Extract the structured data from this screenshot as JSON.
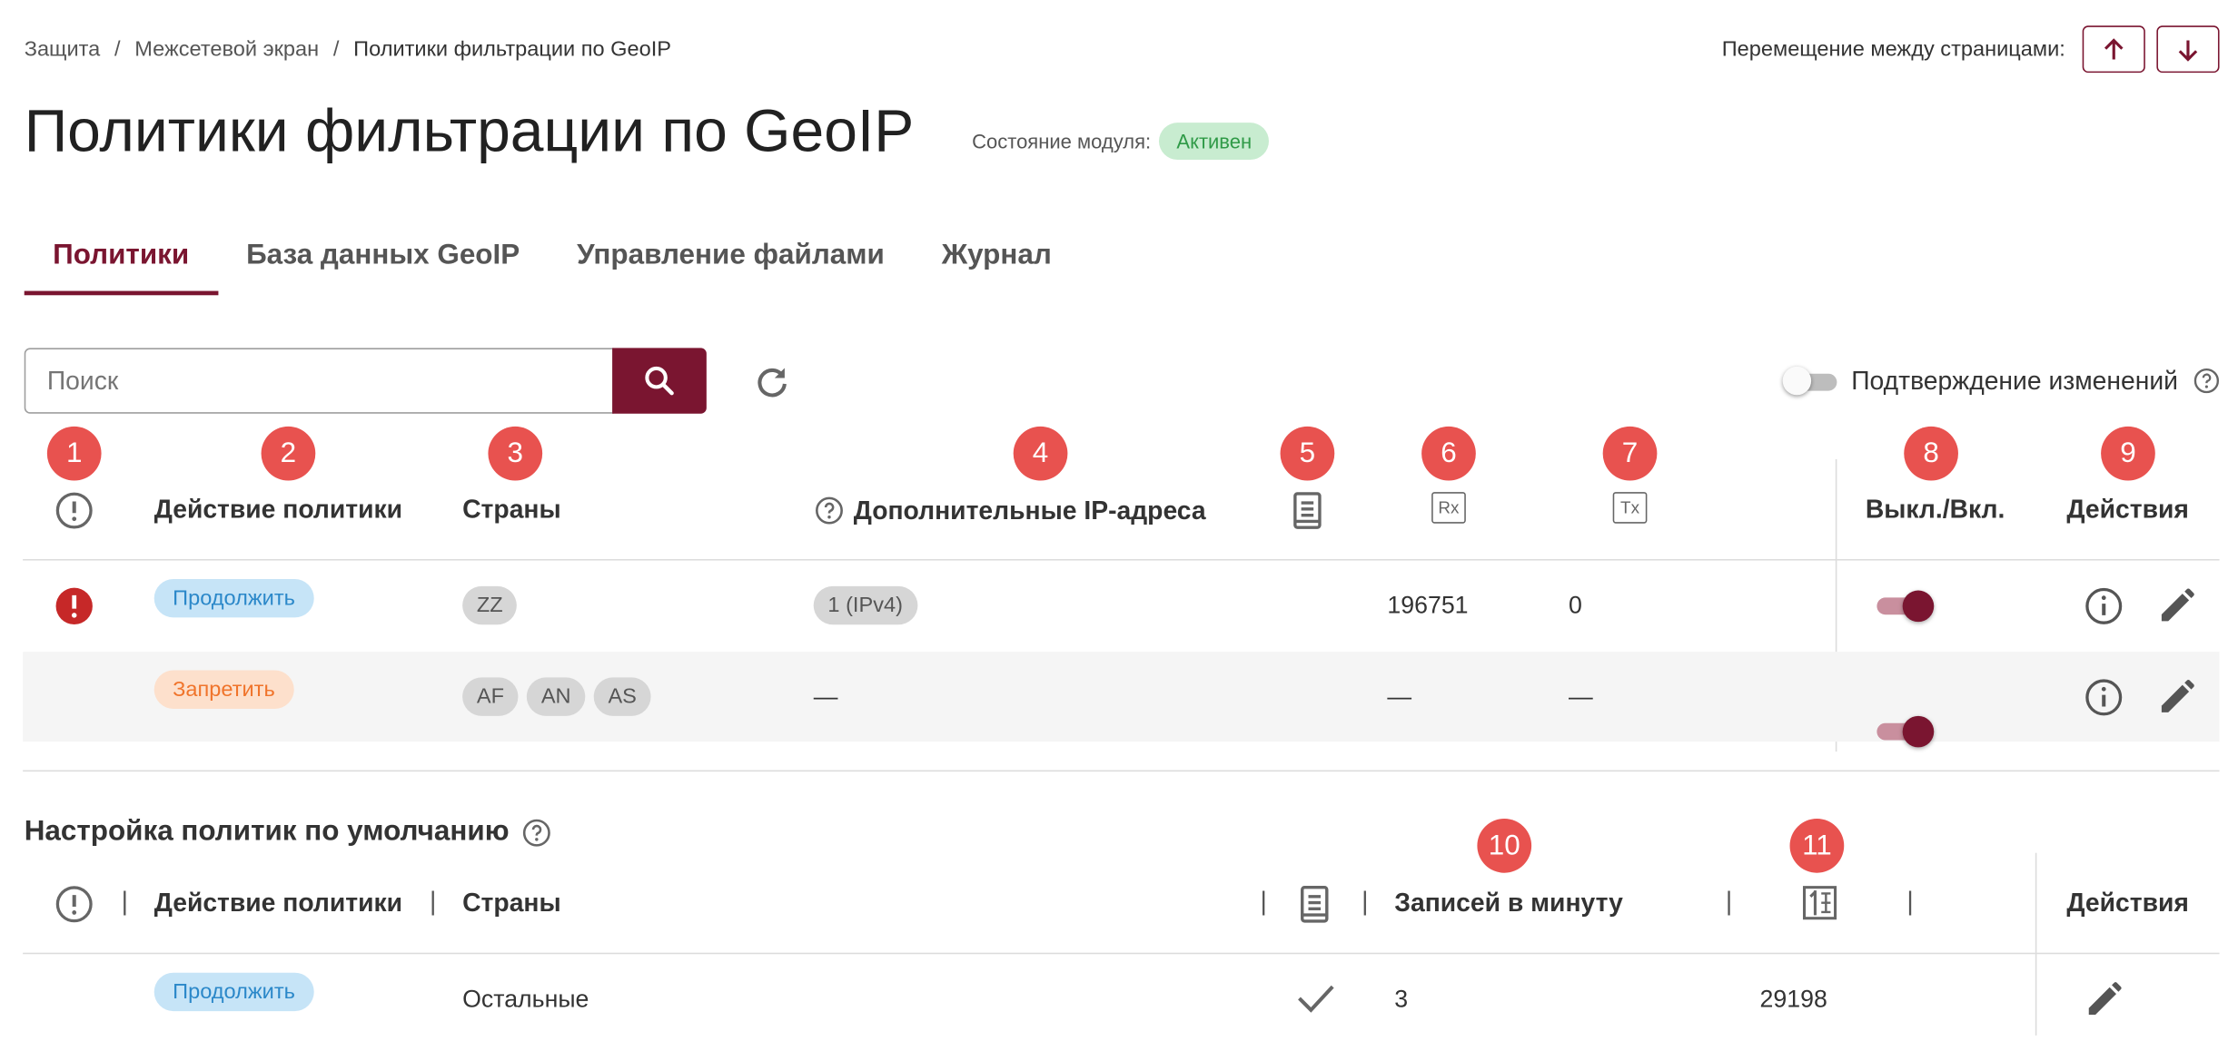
{
  "breadcrumb": [
    "Защита",
    "Межсетевой экран",
    "Политики фильтрации по GeoIP"
  ],
  "page_nav": {
    "label": "Перемещение между страницами:",
    "up_icon": "arrow-up-icon",
    "down_icon": "arrow-down-icon"
  },
  "title": "Политики фильтрации по GeoIP",
  "module_state": {
    "label": "Состояние модуля:",
    "value": "Активен",
    "color": "#2f9a47"
  },
  "tabs": [
    {
      "label": "Политики",
      "active": true
    },
    {
      "label": "База данных GeoIP",
      "active": false
    },
    {
      "label": "Управление файлами",
      "active": false
    },
    {
      "label": "Журнал",
      "active": false
    }
  ],
  "search": {
    "placeholder": "Поиск"
  },
  "confirm_changes": {
    "label": "Подтверждение изменений",
    "enabled": false
  },
  "markers": [
    "1",
    "2",
    "3",
    "4",
    "5",
    "6",
    "7",
    "8",
    "9",
    "10",
    "11"
  ],
  "table": {
    "headers": {
      "priority_icon": "exclamation-circle-icon",
      "action": "Действие политики",
      "countries": "Страны",
      "extra_ips": "Дополнительные IP-адреса",
      "log_icon": "document-icon",
      "rx": "Rx",
      "tx": "Tx",
      "toggle": "Выкл./Вкл.",
      "actions": "Действия"
    },
    "rows": [
      {
        "warning": true,
        "action": "Продолжить",
        "action_color": "#2b88c9",
        "countries": [
          "ZZ"
        ],
        "extra_ips": "1 (IPv4)",
        "rx": "196751",
        "tx": "0",
        "enabled": true
      },
      {
        "warning": false,
        "action": "Запретить",
        "action_color": "#f0742b",
        "countries": [
          "AF",
          "AN",
          "AS"
        ],
        "extra_ips": "—",
        "rx": "—",
        "tx": "—",
        "enabled": true
      }
    ]
  },
  "defaults": {
    "title": "Настройка политик по умолчанию",
    "headers": {
      "action": "Действие политики",
      "countries": "Страны",
      "records_per_minute": "Записей в минуту",
      "counter_icon": "counter-icon",
      "actions": "Действия"
    },
    "row": {
      "action": "Продолжить",
      "countries": "Остальные",
      "log": true,
      "records_per_minute": "3",
      "counter": "29198"
    }
  },
  "colors": {
    "accent": "#7a1530",
    "marker": "#e8524f",
    "warning": "#c62828"
  }
}
